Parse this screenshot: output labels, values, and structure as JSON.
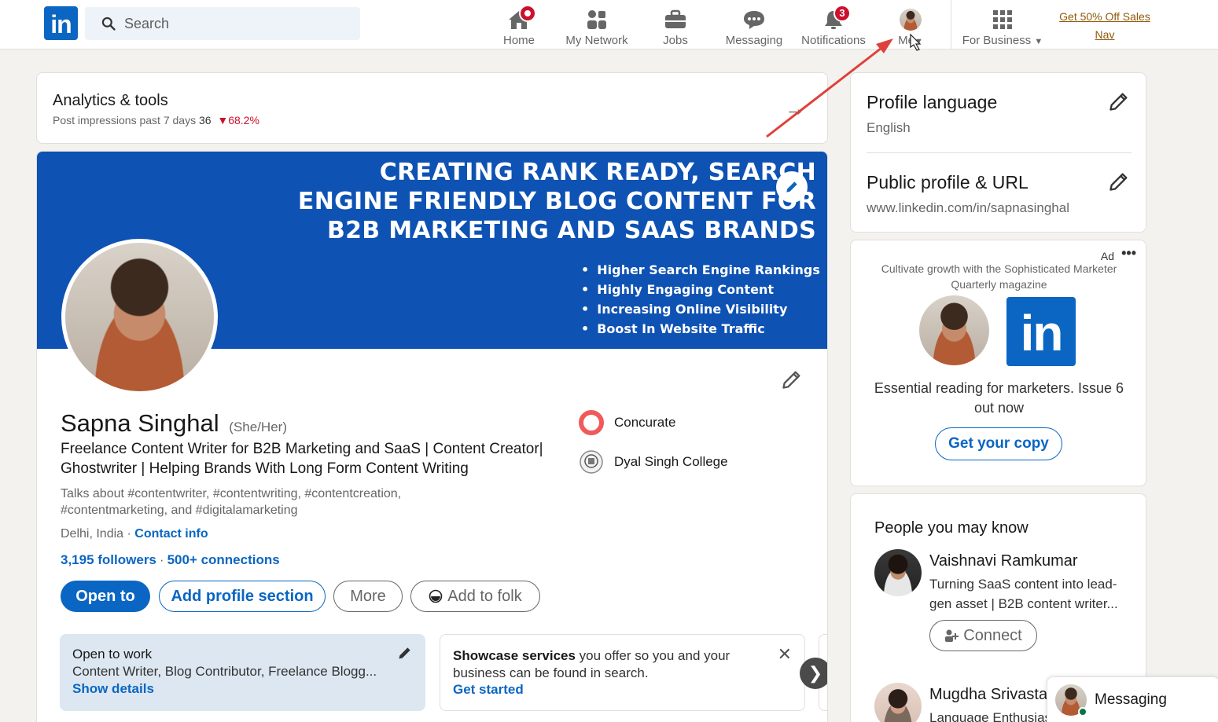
{
  "topnav": {
    "logo": "in",
    "search_placeholder": "Search",
    "items": [
      {
        "label": "Home",
        "badge": ""
      },
      {
        "label": "My Network",
        "badge": ""
      },
      {
        "label": "Jobs",
        "badge": ""
      },
      {
        "label": "Messaging",
        "badge": ""
      },
      {
        "label": "Notifications",
        "badge": "3"
      },
      {
        "label": "Me"
      },
      {
        "label": "For Business"
      }
    ],
    "promo_line1": "Get 50% Off Sales",
    "promo_line2": "Nav"
  },
  "analytics": {
    "title": "Analytics & tools",
    "subtitle": "Post impressions past 7 days",
    "value": "36",
    "change": "68.2%"
  },
  "banner": {
    "headline_line1": "CREATING RANK READY, SEARCH",
    "headline_line2": "ENGINE FRIENDLY BLOG CONTENT FOR",
    "headline_line3": "B2B MARKETING AND SAAS BRANDS",
    "bullets": [
      "Higher Search Engine Rankings",
      "Highly Engaging Content",
      "Increasing Online Visibility",
      "Boost In Website Traffic"
    ]
  },
  "profile": {
    "name": "Sapna Singhal",
    "pronouns": "(She/Her)",
    "headline": "Freelance Content Writer for B2B Marketing and SaaS | Content Creator| Ghostwriter | Helping Brands With Long Form Content Writing",
    "talks_about": "Talks about #contentwriter, #contentwriting, #contentcreation, #contentmarketing, and #digitalamarketing",
    "location": "Delhi, India",
    "contact_info": "Contact info",
    "followers": "3,195 followers",
    "connections": "500+ connections",
    "orgs": [
      {
        "name": "Concurate"
      },
      {
        "name": "Dyal Singh College"
      }
    ],
    "buttons": {
      "open_to": "Open to",
      "add_section": "Add profile section",
      "more": "More",
      "add_to_folk": "Add to folk"
    }
  },
  "open_to_work": {
    "title": "Open to work",
    "roles": "Content Writer, Blog Contributor, Freelance Blogg...",
    "show_details": "Show details"
  },
  "showcase": {
    "bold": "Showcase services",
    "text": " you offer so you and your business can be found in search.",
    "cta": "Get started"
  },
  "profile_settings": {
    "language_title": "Profile language",
    "language_value": "English",
    "url_title": "Public profile & URL",
    "url_value": "www.linkedin.com/in/sapnasinghal"
  },
  "ad": {
    "label": "Ad",
    "more": "•••",
    "tagline": "Cultivate growth with the Sophisticated Marketer Quarterly magazine",
    "logo": "in",
    "body": "Essential reading for marketers. Issue 6 out now",
    "cta": "Get your copy"
  },
  "pymk": {
    "title": "People you may know",
    "people": [
      {
        "name": "Vaishnavi Ramkumar",
        "desc": "Turning SaaS content into lead-gen asset | B2B content writer..."
      },
      {
        "name": "Mugdha Srivastava",
        "desc": "Language Enthusiast"
      }
    ],
    "connect_label": "Connect"
  },
  "messaging": {
    "label": "Messaging"
  },
  "colors": {
    "accent": "#0a66c2",
    "banner": "#0e52b4",
    "alert": "#cb112d",
    "annotation_arrow": "#e0403a"
  }
}
